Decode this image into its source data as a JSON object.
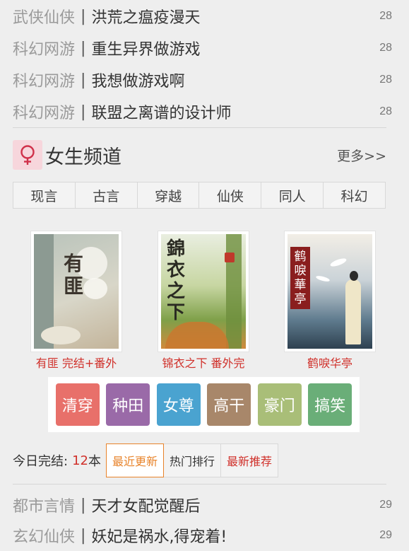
{
  "top_list": [
    {
      "category": "武侠仙侠",
      "title": "洪荒之瘟疫漫天",
      "num": "28"
    },
    {
      "category": "科幻网游",
      "title": "重生异界做游戏",
      "num": "28"
    },
    {
      "category": "科幻网游",
      "title": "我想做游戏啊",
      "num": "28"
    },
    {
      "category": "科幻网游",
      "title": "联盟之离谱的设计师",
      "num": "28"
    }
  ],
  "separator": "|",
  "channel": {
    "title": "女生频道",
    "more": "更多>>",
    "icon": "female-symbol-icon"
  },
  "tabs": [
    "现言",
    "古言",
    "穿越",
    "仙侠",
    "同人",
    "科幻"
  ],
  "books": [
    {
      "cover_text": "有匪",
      "caption": "有匪 完结+番外"
    },
    {
      "cover_text": "錦衣之下",
      "caption": "锦衣之下 番外完"
    },
    {
      "cover_text": "鹤唳華亭",
      "caption": "鹤唳华亭"
    }
  ],
  "genres": [
    {
      "label": "清穿",
      "color": "#e8706a"
    },
    {
      "label": "种田",
      "color": "#9a6aa8"
    },
    {
      "label": "女尊",
      "color": "#4aa3d0"
    },
    {
      "label": "高干",
      "color": "#a8876a"
    },
    {
      "label": "豪门",
      "color": "#a9be78"
    },
    {
      "label": "搞笑",
      "color": "#6aae78"
    }
  ],
  "stats": {
    "label": "今日完结:",
    "count": "12",
    "unit": "本",
    "tabs": [
      "最近更新",
      "热门排行",
      "最新推荐"
    ]
  },
  "bottom_list": [
    {
      "category": "都市言情",
      "title": "天才女配觉醒后",
      "num": "29"
    },
    {
      "category": "玄幻仙侠",
      "title": "妖妃是祸水,得宠着!",
      "num": "29"
    }
  ]
}
